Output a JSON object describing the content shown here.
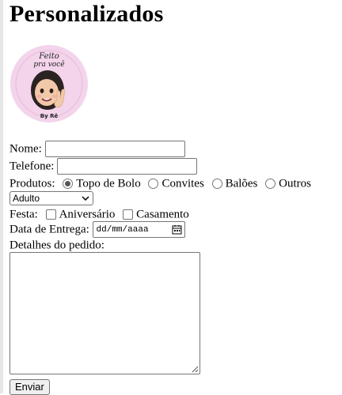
{
  "page": {
    "title": "Personalizados"
  },
  "logo": {
    "line1": "Feito",
    "line2": "pra você",
    "signature": "By Rê"
  },
  "form": {
    "nome_label": "Nome:",
    "telefone_label": "Telefone:",
    "produtos_label": "Produtos:",
    "produtos_options": [
      "Topo de Bolo",
      "Convites",
      "Balões",
      "Outros"
    ],
    "produtos_selected": "Topo de Bolo",
    "tipo_select_value": "Adulto",
    "festa_label": "Festa:",
    "festa_options": [
      "Aniversário",
      "Casamento"
    ],
    "data_label": "Data de Entrega:",
    "data_placeholder": "dd/mm/aaaa",
    "detalhes_label": "Detalhes do pedido:",
    "submit_label": "Enviar"
  },
  "icons": {
    "calendar": "calendar-icon",
    "dropdown": "chevron-down-icon",
    "resize": "resize-grip-icon"
  }
}
